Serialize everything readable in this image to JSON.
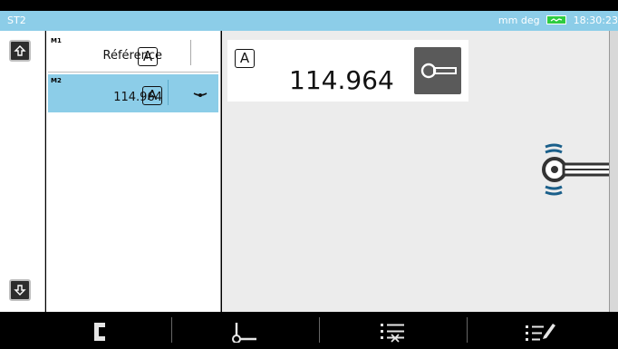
{
  "header": {
    "title": "ST2",
    "units": "mm deg",
    "time": "18:30:23"
  },
  "list": {
    "items": [
      {
        "index": "M1",
        "label": "Référence",
        "mode": "A"
      },
      {
        "index": "M2",
        "label": "114.964",
        "mode": "A"
      }
    ]
  },
  "readout": {
    "mode": "A",
    "value": "114.964"
  },
  "colors": {
    "accent": "#8ccde8",
    "battery": "#2ecc40",
    "toolbar": "#000000"
  },
  "icons": [
    "scroll-up-icon",
    "scroll-down-icon",
    "bracket-icon",
    "probe-point-icon",
    "list-delete-icon",
    "list-edit-icon",
    "probe-icon",
    "sensor-icon"
  ]
}
